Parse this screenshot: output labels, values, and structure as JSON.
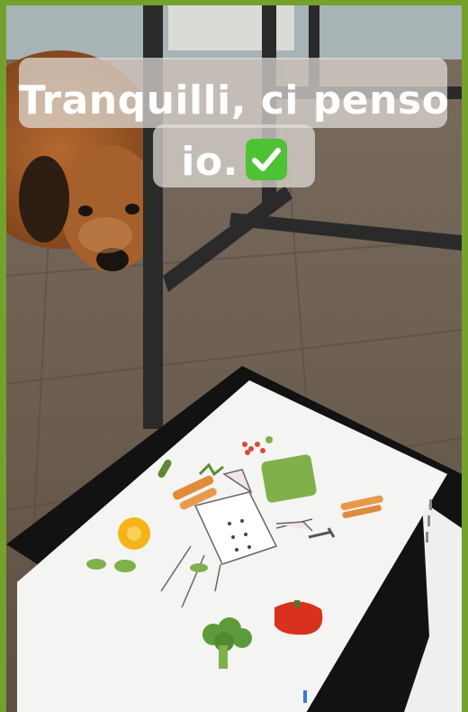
{
  "caption": {
    "line1": "Tranquilli, ci penso",
    "line2": "io.",
    "emoji": "check-mark-button-icon"
  },
  "colors": {
    "border": "#74a12c",
    "floor": "#6b5d4e",
    "caption_bg": "#e1ded8",
    "check_green": "#4fc135"
  }
}
